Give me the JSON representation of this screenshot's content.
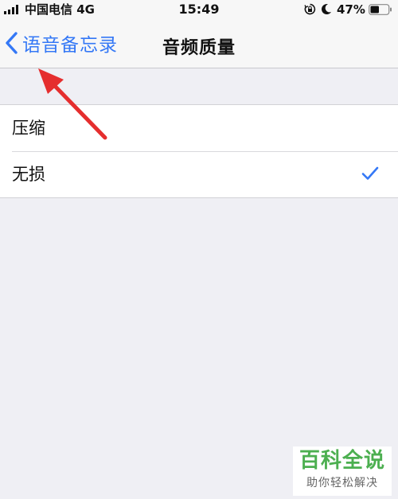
{
  "status_bar": {
    "carrier": "中国电信 4G",
    "time": "15:49",
    "battery": "47%",
    "icons": [
      "signal-icon",
      "lock-rotation-icon",
      "moon-icon",
      "battery-icon"
    ]
  },
  "nav": {
    "back_label": "语音备忘录",
    "title": "音频质量"
  },
  "settings": {
    "items": [
      {
        "label": "压缩",
        "selected": false
      },
      {
        "label": "无损",
        "selected": true
      }
    ]
  },
  "watermark": {
    "title": "百科全说",
    "subtitle": "助你轻松解决"
  },
  "colors": {
    "accent": "#3478f6",
    "background": "#efeff4",
    "annotation": "#e52e2e",
    "watermark": "#4caf50"
  }
}
